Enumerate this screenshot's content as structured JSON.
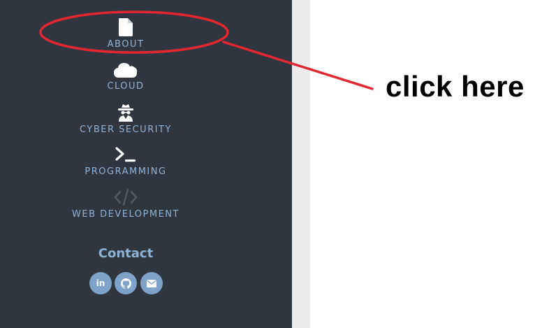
{
  "sidebar": {
    "items": [
      {
        "label": "ABOUT",
        "icon": "file-icon"
      },
      {
        "label": "CLOUD",
        "icon": "cloud-icon"
      },
      {
        "label": "CYBER SECURITY",
        "icon": "spy-icon"
      },
      {
        "label": "PROGRAMMING",
        "icon": "terminal-icon"
      },
      {
        "label": "WEB DEVELOPMENT",
        "icon": "code-icon"
      }
    ],
    "contact": {
      "title": "Contact",
      "links": [
        {
          "icon": "linkedin-icon",
          "text": "in"
        },
        {
          "icon": "github-icon"
        },
        {
          "icon": "envelope-icon"
        }
      ]
    }
  },
  "annotation": {
    "text": "click here",
    "color": "#e3262f"
  },
  "colors": {
    "sidebar_bg": "#2f3640",
    "label": "#8fb3d6",
    "social_bg": "#7ea2c8",
    "divider": "#ececec"
  }
}
